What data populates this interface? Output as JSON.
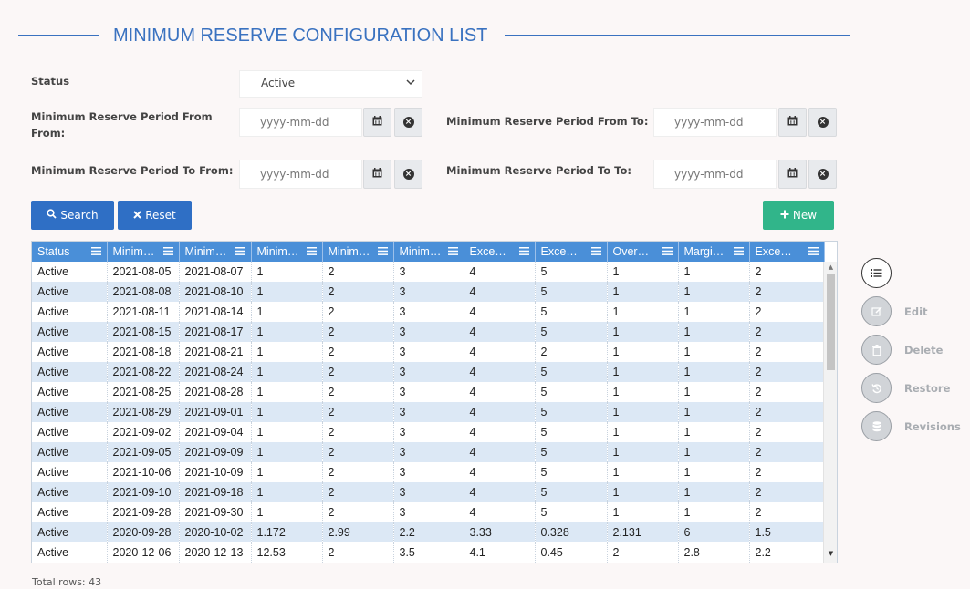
{
  "page": {
    "title": "MINIMUM RESERVE CONFIGURATION LIST"
  },
  "filters": {
    "status_label": "Status",
    "status_value": "Active",
    "period_from_from_label": "Minimum Reserve Period From From:",
    "period_from_to_label": "Minimum Reserve Period From To:",
    "period_to_from_label": "Minimum Reserve Period To From:",
    "period_to_to_label": "Minimum Reserve Period To To:",
    "date_placeholder": "yyyy-mm-dd"
  },
  "buttons": {
    "search": "Search",
    "reset": "Reset",
    "new": "New"
  },
  "table": {
    "columns": [
      "Status",
      "Minim…",
      "Minim…",
      "Minim…",
      "Minim…",
      "Minim…",
      "Exce…",
      "Exce…",
      "Over…",
      "Margi…",
      "Exce…"
    ],
    "rows": [
      [
        "Active",
        "2021-08-05",
        "2021-08-07",
        "1",
        "2",
        "3",
        "4",
        "5",
        "1",
        "1",
        "2"
      ],
      [
        "Active",
        "2021-08-08",
        "2021-08-10",
        "1",
        "2",
        "3",
        "4",
        "5",
        "1",
        "1",
        "2"
      ],
      [
        "Active",
        "2021-08-11",
        "2021-08-14",
        "1",
        "2",
        "3",
        "4",
        "5",
        "1",
        "1",
        "2"
      ],
      [
        "Active",
        "2021-08-15",
        "2021-08-17",
        "1",
        "2",
        "3",
        "4",
        "5",
        "1",
        "1",
        "2"
      ],
      [
        "Active",
        "2021-08-18",
        "2021-08-21",
        "1",
        "2",
        "3",
        "4",
        "2",
        "1",
        "1",
        "2"
      ],
      [
        "Active",
        "2021-08-22",
        "2021-08-24",
        "1",
        "2",
        "3",
        "4",
        "5",
        "1",
        "1",
        "2"
      ],
      [
        "Active",
        "2021-08-25",
        "2021-08-28",
        "1",
        "2",
        "3",
        "4",
        "5",
        "1",
        "1",
        "2"
      ],
      [
        "Active",
        "2021-08-29",
        "2021-09-01",
        "1",
        "2",
        "3",
        "4",
        "5",
        "1",
        "1",
        "2"
      ],
      [
        "Active",
        "2021-09-02",
        "2021-09-04",
        "1",
        "2",
        "3",
        "4",
        "5",
        "1",
        "1",
        "2"
      ],
      [
        "Active",
        "2021-09-05",
        "2021-09-09",
        "1",
        "2",
        "3",
        "4",
        "5",
        "1",
        "1",
        "2"
      ],
      [
        "Active",
        "2021-10-06",
        "2021-10-09",
        "1",
        "2",
        "3",
        "4",
        "5",
        "1",
        "1",
        "2"
      ],
      [
        "Active",
        "2021-09-10",
        "2021-09-18",
        "1",
        "2",
        "3",
        "4",
        "5",
        "1",
        "1",
        "2"
      ],
      [
        "Active",
        "2021-09-28",
        "2021-09-30",
        "1",
        "2",
        "3",
        "4",
        "5",
        "1",
        "1",
        "2"
      ],
      [
        "Active",
        "2020-09-28",
        "2020-10-02",
        "1.172",
        "2.99",
        "2.2",
        "3.33",
        "0.328",
        "2.131",
        "6",
        "1.5"
      ],
      [
        "Active",
        "2020-12-06",
        "2020-12-13",
        "12.53",
        "2",
        "3.5",
        "4.1",
        "0.45",
        "2",
        "2.8",
        "2.2"
      ]
    ],
    "total_label": "Total rows: 43"
  },
  "actions": {
    "edit": "Edit",
    "delete": "Delete",
    "restore": "Restore",
    "revisions": "Revisions"
  },
  "icons": {
    "search": "search-icon",
    "reset": "times-icon",
    "new": "plus-icon",
    "calendar": "calendar-icon",
    "clear": "clear-icon",
    "column_menu": "hamburger-icon",
    "list": "list-icon",
    "edit": "edit-icon",
    "delete": "trash-icon",
    "restore": "restore-icon",
    "revisions": "database-icon"
  },
  "colors": {
    "accent": "#3a72c0",
    "primary_button": "#2f6fc5",
    "success_button": "#31b58a",
    "header_bg": "#4a8fd8",
    "alt_row_bg": "#dce8f5"
  }
}
